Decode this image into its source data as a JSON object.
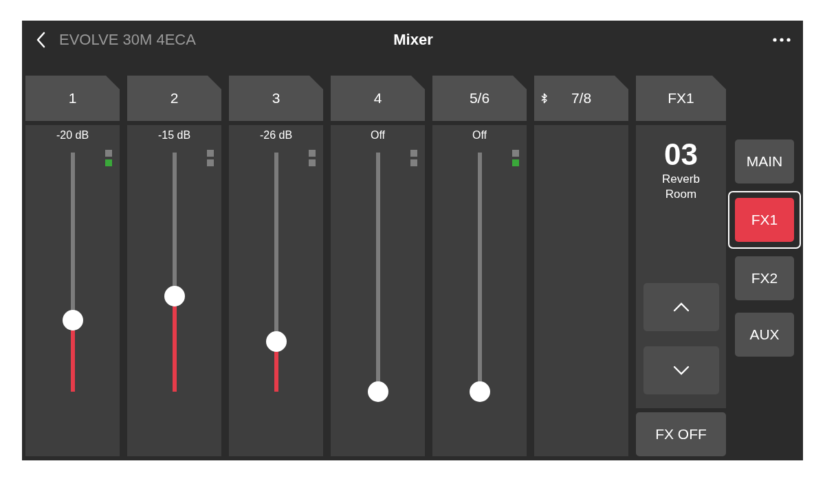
{
  "header": {
    "back_label": "EVOLVE 30M 4ECA",
    "title": "Mixer"
  },
  "channels": [
    {
      "label": "1",
      "bluetooth": false,
      "kind": "fader",
      "reading": "-20 dB",
      "level": 0.3,
      "signal": true
    },
    {
      "label": "2",
      "bluetooth": false,
      "kind": "fader",
      "reading": "-15 dB",
      "level": 0.4,
      "signal": false
    },
    {
      "label": "3",
      "bluetooth": false,
      "kind": "fader",
      "reading": "-26 dB",
      "level": 0.21,
      "signal": false
    },
    {
      "label": "4",
      "bluetooth": false,
      "kind": "fader",
      "reading": "Off",
      "level": 0,
      "signal": false
    },
    {
      "label": "5/6",
      "bluetooth": false,
      "kind": "fader",
      "reading": "Off",
      "level": 0,
      "signal": true
    },
    {
      "label": "7/8",
      "bluetooth": true,
      "kind": "empty"
    }
  ],
  "fx": {
    "label": "FX1",
    "preset_number": "03",
    "preset_name": "Reverb Room",
    "off_button": "FX OFF"
  },
  "buses": [
    {
      "label": "MAIN",
      "selected": false
    },
    {
      "label": "FX1",
      "selected": true
    },
    {
      "label": "FX2",
      "selected": false
    },
    {
      "label": "AUX",
      "selected": false
    }
  ]
}
